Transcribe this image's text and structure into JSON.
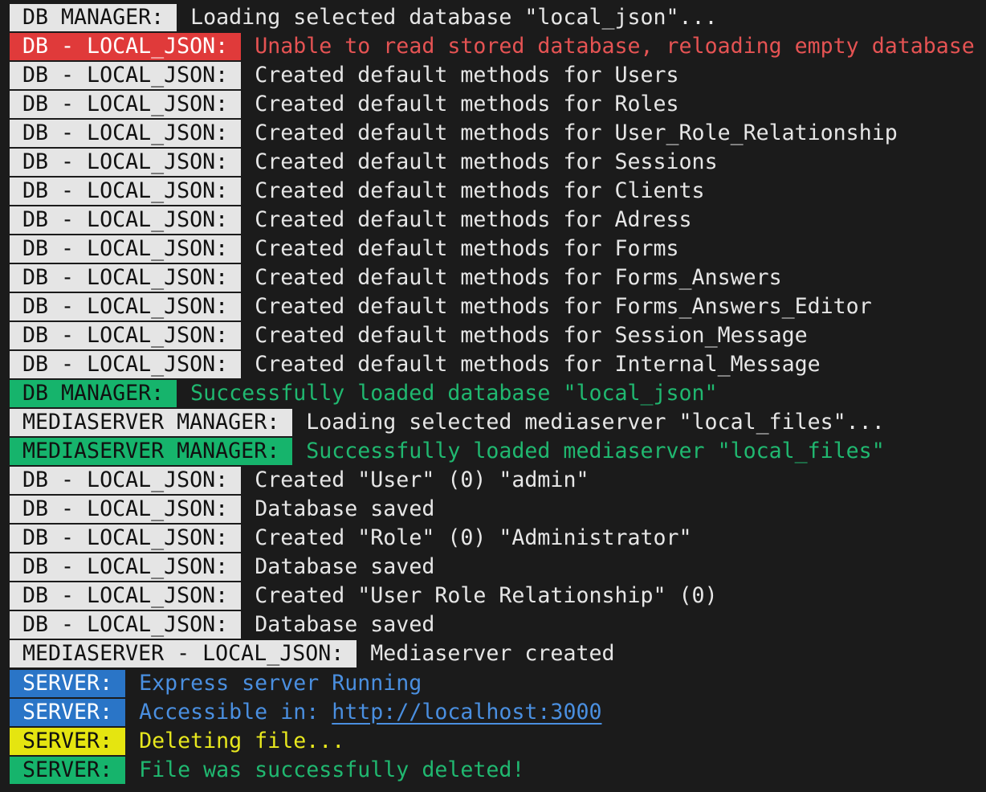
{
  "colors": {
    "background": "#1b1b1b",
    "tag_default": "#e5e5e5",
    "tag_error": "#e03a3a",
    "tag_success": "#16b46c",
    "tag_info": "#2a75c7",
    "tag_warn": "#e5e510",
    "text_default": "#e6e6e6",
    "text_error": "#e55353",
    "text_success": "#20b870",
    "text_info": "#4a8fe0",
    "text_warn": "#e8e81e"
  },
  "lines": [
    {
      "tag": "DB MANAGER:",
      "msg": "Loading selected database \"local_json\"..."
    },
    {
      "tag": "DB - LOCAL_JSON:",
      "msg": "Unable to read stored database, reloading empty database"
    },
    {
      "tag": "DB - LOCAL_JSON:",
      "msg": "Created default methods for Users"
    },
    {
      "tag": "DB - LOCAL_JSON:",
      "msg": "Created default methods for Roles"
    },
    {
      "tag": "DB - LOCAL_JSON:",
      "msg": "Created default methods for User_Role_Relationship"
    },
    {
      "tag": "DB - LOCAL_JSON:",
      "msg": "Created default methods for Sessions"
    },
    {
      "tag": "DB - LOCAL_JSON:",
      "msg": "Created default methods for Clients"
    },
    {
      "tag": "DB - LOCAL_JSON:",
      "msg": "Created default methods for Adress"
    },
    {
      "tag": "DB - LOCAL_JSON:",
      "msg": "Created default methods for Forms"
    },
    {
      "tag": "DB - LOCAL_JSON:",
      "msg": "Created default methods for Forms_Answers"
    },
    {
      "tag": "DB - LOCAL_JSON:",
      "msg": "Created default methods for Forms_Answers_Editor"
    },
    {
      "tag": "DB - LOCAL_JSON:",
      "msg": "Created default methods for Session_Message"
    },
    {
      "tag": "DB - LOCAL_JSON:",
      "msg": "Created default methods for Internal_Message"
    },
    {
      "tag": "DB MANAGER:",
      "msg": "Successfully loaded database \"local_json\""
    },
    {
      "tag": "MEDIASERVER MANAGER:",
      "msg": "Loading selected mediaserver \"local_files\"..."
    },
    {
      "tag": "MEDIASERVER MANAGER:",
      "msg": "Successfully loaded mediaserver \"local_files\""
    },
    {
      "tag": "DB - LOCAL_JSON:",
      "msg": "Created \"User\" (0) \"admin\""
    },
    {
      "tag": "DB - LOCAL_JSON:",
      "msg": "Database saved"
    },
    {
      "tag": "DB - LOCAL_JSON:",
      "msg": "Created \"Role\" (0) \"Administrator\""
    },
    {
      "tag": "DB - LOCAL_JSON:",
      "msg": "Database saved"
    },
    {
      "tag": "DB - LOCAL_JSON:",
      "msg": "Created \"User Role Relationship\" (0)"
    },
    {
      "tag": "DB - LOCAL_JSON:",
      "msg": "Database saved"
    },
    {
      "tag": "MEDIASERVER - LOCAL_JSON:",
      "msg": "Mediaserver created"
    },
    {
      "tag": "SERVER:",
      "msg": "Express server Running"
    },
    {
      "tag": "SERVER:",
      "msg": "Accessible in: ",
      "link": "http://localhost:3000"
    },
    {
      "tag": "SERVER:",
      "msg": "Deleting file..."
    },
    {
      "tag": "SERVER:",
      "msg": "File was successfully deleted!"
    }
  ]
}
